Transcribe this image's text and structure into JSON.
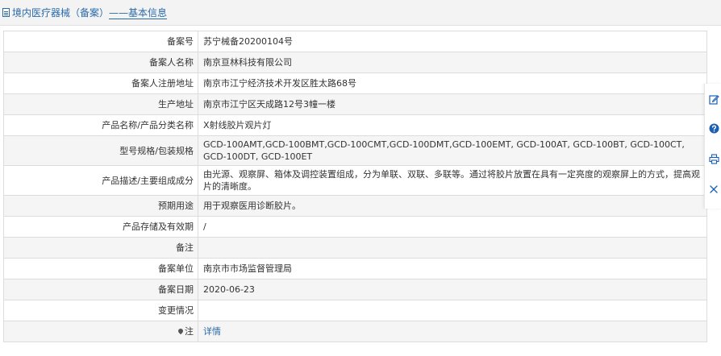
{
  "header": {
    "prefix": "境内医疗器械（备案）",
    "separator": "——",
    "section": "基本信息"
  },
  "rows": [
    {
      "label": "备案号",
      "value": "苏宁械备20200104号"
    },
    {
      "label": "备案人名称",
      "value": "南京亘林科技有限公司"
    },
    {
      "label": "备案人注册地址",
      "value": "南京市江宁经济技术开发区胜太路68号"
    },
    {
      "label": "生产地址",
      "value": "南京市江宁区天成路12号3幢一楼"
    },
    {
      "label": "产品名称/产品分类名称",
      "value": "X射线胶片观片灯"
    },
    {
      "label": "型号规格/包装规格",
      "value": "GCD-100AMT,GCD-100BMT,GCD-100CMT,GCD-100DMT,GCD-100EMT, GCD-100AT, GCD-100BT, GCD-100CT, GCD-100DT, GCD-100ET"
    },
    {
      "label": "产品描述/主要组成成分",
      "value": "由光源、观察屏、箱体及调控装置组成，分为单联、双联、多联等。通过将胶片放置在具有一定亮度的观察屏上的方式，提高观片的清晰度。"
    },
    {
      "label": "预期用途",
      "value": "用于观察医用诊断胶片。"
    },
    {
      "label": "产品存储及有效期",
      "value": "/"
    },
    {
      "label": "备注",
      "value": ""
    },
    {
      "label": "备案单位",
      "value": "南京市市场监督管理局"
    },
    {
      "label": "备案日期",
      "value": "2020-06-23"
    },
    {
      "label": "变更情况",
      "value": ""
    },
    {
      "label": "注",
      "value": "详情"
    }
  ],
  "icons": {
    "header": "document-icon",
    "note": "pin-icon",
    "side": [
      "edit-icon",
      "help-icon",
      "print-icon",
      "close-icon"
    ]
  },
  "colors": {
    "link": "#2a6aa8",
    "help_icon": "#1a5fb4"
  }
}
